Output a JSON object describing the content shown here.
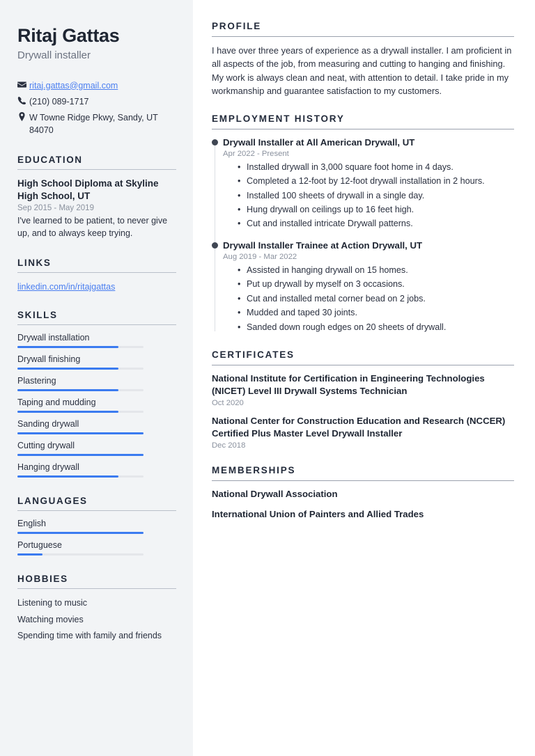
{
  "accent_colors": {
    "link": "#4a7ef0",
    "bar_fill": "#3b7bf0",
    "bar_track": "#e4e6ea",
    "sidebar_bg": "#f2f4f6",
    "heading": "#232b3b",
    "timeline_dot": "#3f4653"
  },
  "header": {
    "name": "Ritaj Gattas",
    "job_title": "Drywall installer"
  },
  "contact": {
    "items": [
      {
        "icon": "envelope-icon",
        "value": "ritaj.gattas@gmail.com",
        "is_link": true
      },
      {
        "icon": "phone-icon",
        "value": "(210) 089-1717",
        "is_link": false
      },
      {
        "icon": "location-pin-icon",
        "value": "W Towne Ridge Pkwy, Sandy, UT 84070",
        "is_link": false
      }
    ]
  },
  "education": {
    "heading": "EDUCATION",
    "entries": [
      {
        "title": "High School Diploma at Skyline High School, UT",
        "date": "Sep 2015 - May 2019",
        "description": "I've learned to be patient, to never give up, and to always keep trying."
      }
    ]
  },
  "links": {
    "heading": "LINKS",
    "items": [
      {
        "label": "linkedin.com/in/ritajgattas"
      }
    ]
  },
  "skills": {
    "heading": "SKILLS",
    "items": [
      {
        "label": "Drywall installation",
        "level": 80
      },
      {
        "label": "Drywall finishing",
        "level": 80
      },
      {
        "label": "Plastering",
        "level": 80
      },
      {
        "label": "Taping and mudding",
        "level": 80
      },
      {
        "label": "Sanding drywall",
        "level": 100
      },
      {
        "label": "Cutting drywall",
        "level": 100
      },
      {
        "label": "Hanging drywall",
        "level": 80
      }
    ]
  },
  "languages": {
    "heading": "LANGUAGES",
    "items": [
      {
        "label": "English",
        "level": 100
      },
      {
        "label": "Portuguese",
        "level": 20
      }
    ]
  },
  "hobbies": {
    "heading": "HOBBIES",
    "items": [
      {
        "label": "Listening to music"
      },
      {
        "label": "Watching movies"
      },
      {
        "label": "Spending time with family and friends"
      }
    ]
  },
  "profile": {
    "heading": "PROFILE",
    "text": "I have over three years of experience as a drywall installer. I am proficient in all aspects of the job, from measuring and cutting to hanging and finishing. My work is always clean and neat, with attention to detail. I take pride in my workmanship and guarantee satisfaction to my customers."
  },
  "employment": {
    "heading": "EMPLOYMENT HISTORY",
    "jobs": [
      {
        "title": "Drywall Installer at All American Drywall, UT",
        "date": "Apr 2022 - Present",
        "points": [
          "Installed drywall in 3,000 square foot home in 4 days.",
          "Completed a 12-foot by 12-foot drywall installation in 2 hours.",
          "Installed 100 sheets of drywall in a single day.",
          "Hung drywall on ceilings up to 16 feet high.",
          "Cut and installed intricate Drywall patterns."
        ]
      },
      {
        "title": "Drywall Installer Trainee at Action Drywall, UT",
        "date": "Aug 2019 - Mar 2022",
        "points": [
          "Assisted in hanging drywall on 15 homes.",
          "Put up drywall by myself on 3 occasions.",
          "Cut and installed metal corner bead on 2 jobs.",
          "Mudded and taped 30 joints.",
          "Sanded down rough edges on 20 sheets of drywall."
        ]
      }
    ]
  },
  "certificates": {
    "heading": "CERTIFICATES",
    "items": [
      {
        "title": "National Institute for Certification in Engineering Technologies (NICET) Level III Drywall Systems Technician",
        "date": "Oct 2020"
      },
      {
        "title": "National Center for Construction Education and Research (NCCER) Certified Plus Master Level Drywall Installer",
        "date": "Dec 2018"
      }
    ]
  },
  "memberships": {
    "heading": "MEMBERSHIPS",
    "items": [
      {
        "label": "National Drywall Association"
      },
      {
        "label": "International Union of Painters and Allied Trades"
      }
    ]
  }
}
